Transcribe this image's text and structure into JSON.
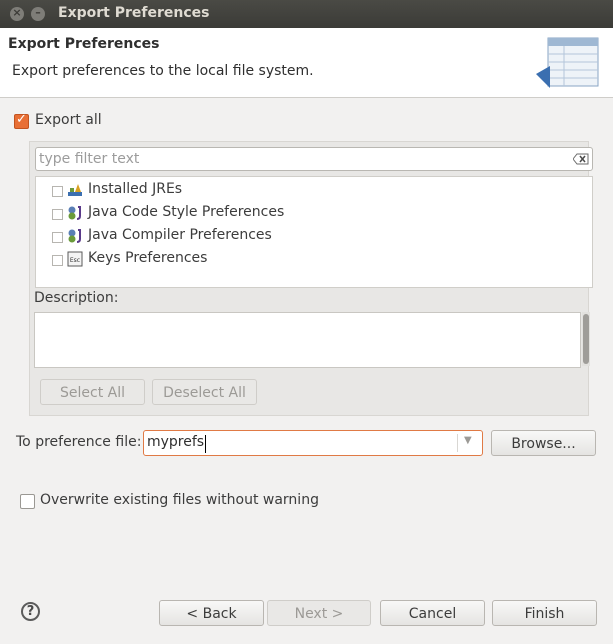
{
  "window": {
    "title": "Export Preferences"
  },
  "header": {
    "title": "Export Preferences",
    "subtitle": "Export preferences to the local file system."
  },
  "export_all": {
    "label": "Export all",
    "checked": true
  },
  "filter": {
    "placeholder": "type filter text",
    "value": ""
  },
  "tree": {
    "items": [
      {
        "label": "Installed JREs",
        "icon": "jre-icon",
        "checked": false
      },
      {
        "label": "Java Code Style Preferences",
        "icon": "java-prefs-icon",
        "checked": false
      },
      {
        "label": "Java Compiler Preferences",
        "icon": "java-prefs-icon",
        "checked": false
      },
      {
        "label": "Keys Preferences",
        "icon": "keys-esc-icon",
        "checked": false
      }
    ]
  },
  "description": {
    "label": "Description:",
    "text": ""
  },
  "buttons": {
    "select_all": "Select All",
    "deselect_all": "Deselect All",
    "browse": "Browse...",
    "back": "< Back",
    "next": "Next >",
    "cancel": "Cancel",
    "finish": "Finish"
  },
  "pref_file": {
    "label": "To preference file:",
    "value": "myprefs"
  },
  "overwrite": {
    "label": "Overwrite existing files without warning",
    "checked": false
  },
  "help": {
    "glyph": "?"
  },
  "colors": {
    "accent": "#e86f35",
    "titlebar": "#3c3b37"
  }
}
